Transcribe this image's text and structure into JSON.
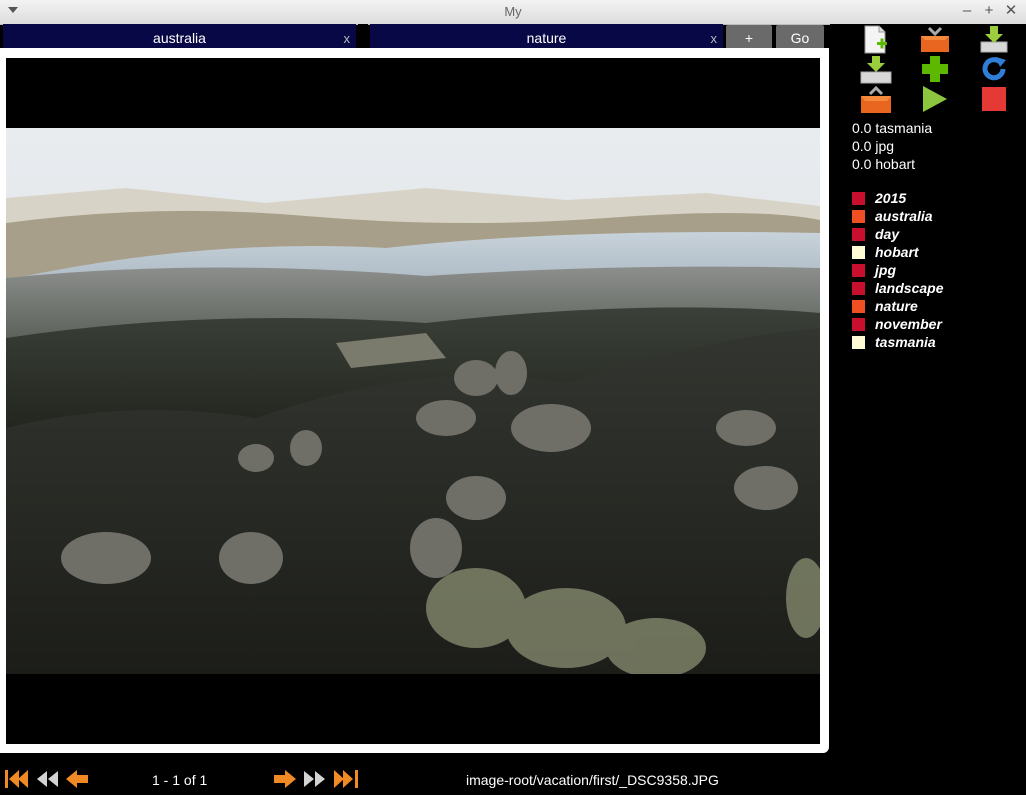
{
  "window": {
    "title": "My"
  },
  "tabs": [
    {
      "label": "australia",
      "close": "x"
    },
    {
      "label": "nature",
      "close": "x"
    }
  ],
  "buttons": {
    "plus": "+",
    "go": "Go"
  },
  "scores": [
    {
      "text": "0.0 tasmania"
    },
    {
      "text": "0.0 jpg"
    },
    {
      "text": "0.0 hobart"
    }
  ],
  "tags": [
    {
      "name": "2015",
      "color": "#c8102e"
    },
    {
      "name": "australia",
      "color": "#f04e23"
    },
    {
      "name": "day",
      "color": "#c8102e"
    },
    {
      "name": "hobart",
      "color": "#fffbd5"
    },
    {
      "name": "jpg",
      "color": "#c8102e"
    },
    {
      "name": "landscape",
      "color": "#c8102e"
    },
    {
      "name": "nature",
      "color": "#f04e23"
    },
    {
      "name": "november",
      "color": "#c8102e"
    },
    {
      "name": "tasmania",
      "color": "#fffbd5"
    }
  ],
  "footer": {
    "page_info": "1 - 1 of 1",
    "file_path": "image-root/vacation/first/_DSC9358.JPG"
  }
}
